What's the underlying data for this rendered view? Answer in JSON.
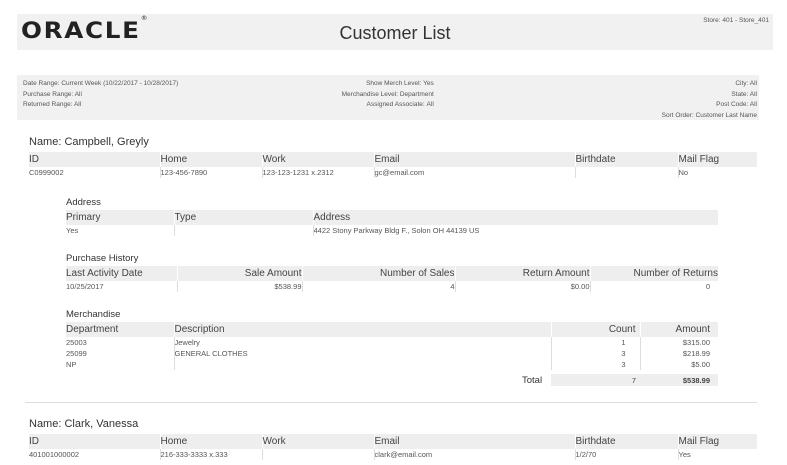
{
  "header": {
    "logo": "ORACLE",
    "logo_mark": "®",
    "title": "Customer List",
    "store": "Store: 401 - Store_401"
  },
  "criteria": {
    "left": [
      {
        "label": "Date Range:",
        "value": "Current Week (10/22/2017 - 10/28/2017)"
      },
      {
        "label": "Purchase Range:",
        "value": "All"
      },
      {
        "label": "Returned Range:",
        "value": "All"
      }
    ],
    "middle": [
      {
        "label": "Show Merch Level:",
        "value": "Yes"
      },
      {
        "label": "Merchandise Level:",
        "value": "Department"
      },
      {
        "label": "Assigned Associate:",
        "value": "All"
      }
    ],
    "right": [
      {
        "label": "City:",
        "value": "All"
      },
      {
        "label": "State:",
        "value": "All"
      },
      {
        "label": "Post Code:",
        "value": "All"
      },
      {
        "label": "Sort Order:",
        "value": "Customer Last Name"
      }
    ]
  },
  "customer_columns": [
    "ID",
    "Home",
    "Work",
    "Email",
    "Birthdate",
    "Mail Flag"
  ],
  "customers": [
    {
      "name": "Name: Campbell, Greyly",
      "id": "C0999002",
      "home": "123-456-7890",
      "work": "123-123-1231 x.2312",
      "email": "gc@email.com",
      "birthdate": "",
      "mail_flag": "No",
      "address": {
        "title": "Address",
        "columns": [
          "Primary",
          "Type",
          "Address"
        ],
        "row": [
          "Yes",
          "",
          "4422 Stony Parkway Bldg F., Solon OH 44139 US"
        ]
      },
      "purchase": {
        "title": "Purchase History",
        "columns": [
          "Last Activity Date",
          "Sale Amount",
          "Number of Sales",
          "Return Amount",
          "Number of Returns"
        ],
        "row": [
          "10/25/2017",
          "$538.99",
          "4",
          "$0.00",
          "0"
        ]
      },
      "merch": {
        "title": "Merchandise",
        "columns": [
          "Department",
          "Description",
          "Count",
          "Amount"
        ],
        "rows": [
          [
            "25003",
            "Jewelry",
            "1",
            "$315.00"
          ],
          [
            "25099",
            "GENERAL CLOTHES",
            "3",
            "$218.99"
          ],
          [
            "NP",
            "",
            "3",
            "$5.00"
          ]
        ],
        "total_label": "Total",
        "total_count": "7",
        "total_amount": "$538.99"
      }
    },
    {
      "name": "Name: Clark, Vanessa",
      "id": "401001000002",
      "home": "216-333-3333 x.333",
      "work": "",
      "email": "clark@email.com",
      "birthdate": "1/2/70",
      "mail_flag": "Yes"
    }
  ]
}
